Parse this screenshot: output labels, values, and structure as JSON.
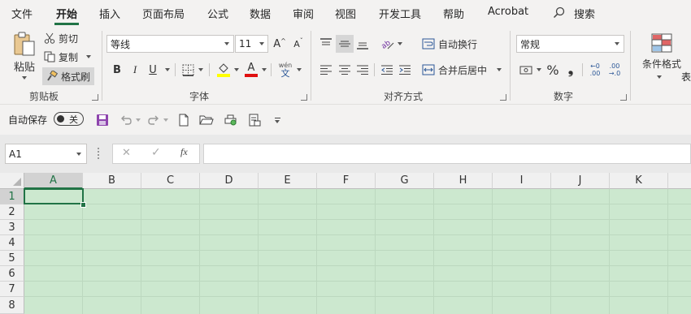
{
  "menu": {
    "tabs": [
      "文件",
      "开始",
      "插入",
      "页面布局",
      "公式",
      "数据",
      "审阅",
      "视图",
      "开发工具",
      "帮助",
      "Acrobat"
    ],
    "active_tab": "开始",
    "search_label": "搜索"
  },
  "ribbon": {
    "clipboard": {
      "paste": "粘贴",
      "cut": "剪切",
      "copy": "复制",
      "format_painter": "格式刷",
      "label": "剪贴板"
    },
    "font": {
      "font_name": "等线",
      "font_size": "11",
      "bold": "B",
      "italic": "I",
      "underline": "U",
      "grow": "A",
      "shrink": "A",
      "phonetic": "wén",
      "phonetic_char": "文",
      "label": "字体"
    },
    "alignment": {
      "wrap_text": "自动换行",
      "merge_center": "合并后居中",
      "label": "对齐方式"
    },
    "number": {
      "format": "常规",
      "percent": "%",
      "comma": "❟",
      "inc_decimal_top": "←0",
      "inc_decimal_bottom": ".00",
      "dec_decimal_top": ".00",
      "dec_decimal_bottom": "→.0",
      "label": "数字"
    },
    "styles": {
      "conditional_format": "条件格式",
      "table_partial": "表"
    }
  },
  "quick_access": {
    "autosave_label": "自动保存",
    "autosave_state": "关"
  },
  "formula_bar": {
    "name_box": "A1",
    "cancel": "✕",
    "enter": "✓",
    "fx": "fx",
    "value": ""
  },
  "sheet": {
    "columns": [
      "A",
      "B",
      "C",
      "D",
      "E",
      "F",
      "G",
      "H",
      "I",
      "J",
      "K"
    ],
    "rows": [
      "1",
      "2",
      "3",
      "4",
      "5",
      "6",
      "7",
      "8"
    ],
    "active_cell": "A1"
  },
  "colors": {
    "accent": "#217346",
    "cell_bg": "#cce8cf",
    "ribbon_bg": "#f3f2f1"
  }
}
